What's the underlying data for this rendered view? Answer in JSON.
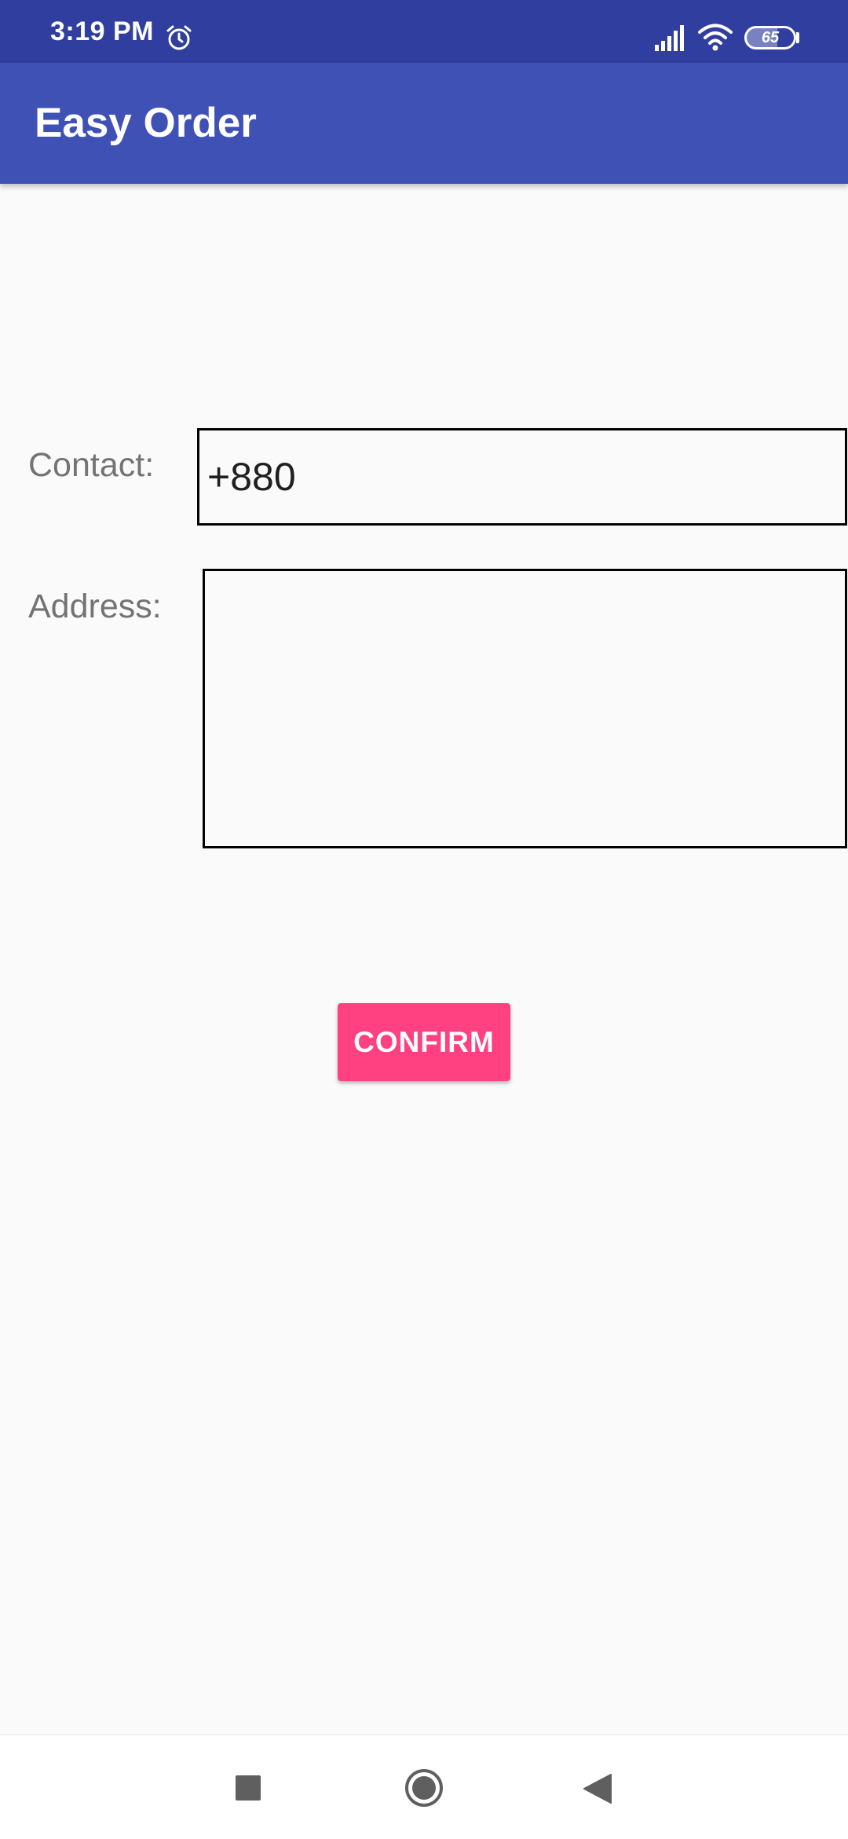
{
  "status_bar": {
    "time": "3:19 PM",
    "battery_level": "65",
    "icons": [
      "alarm-icon",
      "signal-icon",
      "wifi-icon",
      "battery-icon"
    ],
    "background": "#303f9f"
  },
  "app_bar": {
    "title": "Easy Order",
    "background": "#3f51b5"
  },
  "form": {
    "contact_label": "Contact:",
    "contact_value": "+880",
    "address_label": "Address:",
    "address_value": ""
  },
  "confirm_button": {
    "label": "CONFIRM",
    "color": "#ff4081"
  },
  "nav_bar": {
    "icons": [
      "recents-square-icon",
      "home-circle-icon",
      "back-triangle-icon"
    ]
  }
}
